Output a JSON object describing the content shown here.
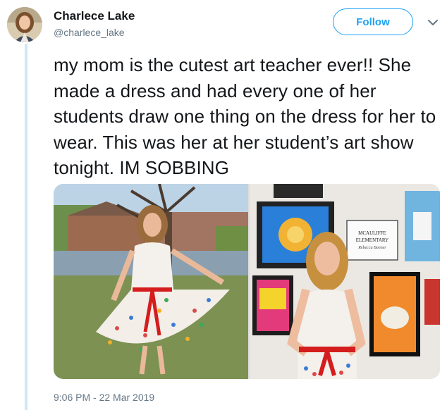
{
  "tweet": {
    "author_name": "Charlece Lake",
    "author_handle": "@charlece_lake",
    "follow_label": "Follow",
    "text": "my mom is the cutest art teacher ever!! She made a dress and had every one of her students draw one thing on the dress for her to wear. This was her at her student’s art show tonight. IM SOBBING",
    "timestamp": "9:06 PM - 22 Mar 2019"
  },
  "photo_right": {
    "sign_lines": [
      "MCAULIFFE",
      "ELEMENTARY",
      "Rebecca Bonner"
    ]
  },
  "colors": {
    "accent": "#1da1f2",
    "secondary_text": "#657786",
    "thread_line": "#cde7f5"
  },
  "icons": {
    "menu": "chevron-down-icon"
  }
}
